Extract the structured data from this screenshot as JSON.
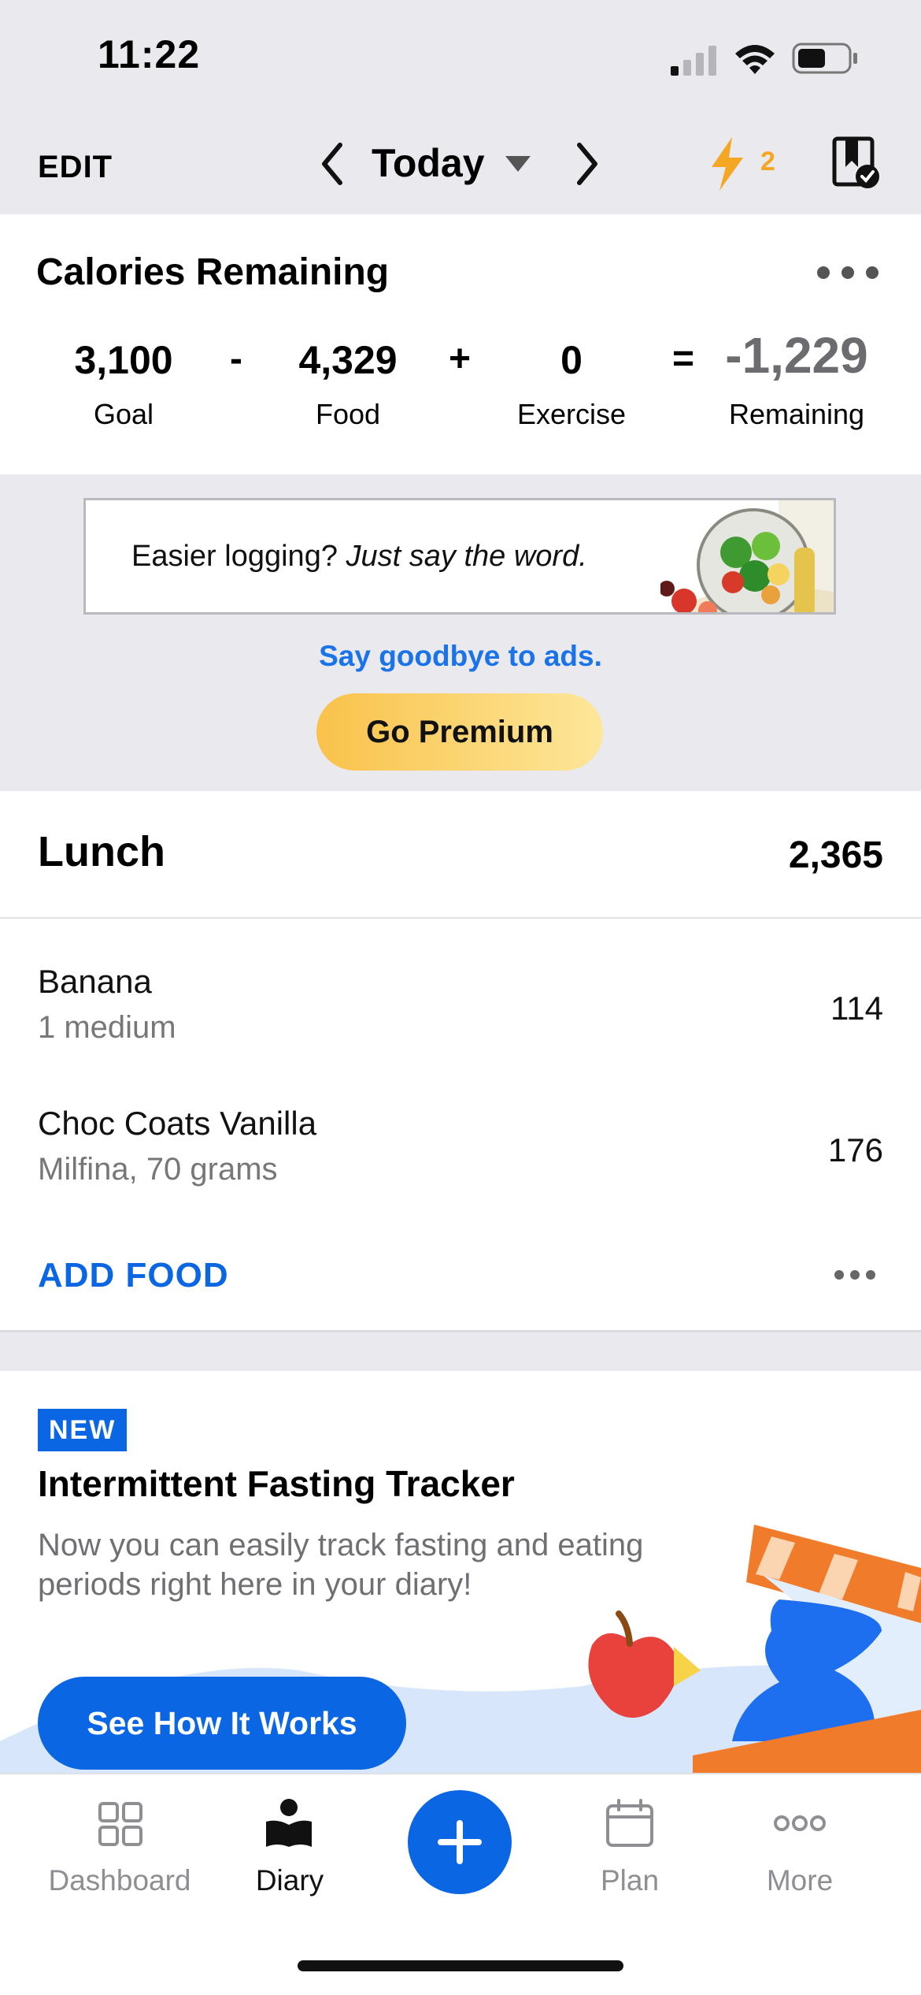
{
  "status_bar": {
    "time": "11:22"
  },
  "header": {
    "edit_label": "EDIT",
    "date_label": "Today",
    "streak_count": "2"
  },
  "calories": {
    "title": "Calories Remaining",
    "goal": "3,100",
    "goal_label": "Goal",
    "op_minus": "-",
    "food": "4,329",
    "food_label": "Food",
    "op_plus": "+",
    "exercise": "0",
    "exercise_label": "Exercise",
    "op_equals": "=",
    "remaining": "-1,229",
    "remaining_label": "Remaining"
  },
  "ad": {
    "text_normal": "Easier logging? ",
    "text_italic": "Just say the word.",
    "remove_ads_link": "Say goodbye to ads.",
    "premium_button": "Go Premium"
  },
  "meal": {
    "title": "Lunch",
    "total": "2,365",
    "items": [
      {
        "name": "Banana",
        "serving": "1 medium",
        "calories": "114"
      },
      {
        "name": "Choc Coats Vanilla",
        "serving": "Milfina, 70 grams",
        "calories": "176"
      }
    ],
    "add_food_label": "ADD FOOD"
  },
  "fasting": {
    "badge": "NEW",
    "title": "Intermittent Fasting Tracker",
    "description": "Now you can easily track fasting and eating periods right here in your diary!",
    "button": "See How It Works"
  },
  "tab_bar": {
    "dashboard": "Dashboard",
    "diary": "Diary",
    "plan": "Plan",
    "more": "More"
  },
  "colors": {
    "accent_blue": "#0b66e4",
    "streak_orange": "#f5a623",
    "premium_yellow": "#f9c24a"
  },
  "icons": [
    "cellular-icon",
    "wifi-icon",
    "battery-icon",
    "chevron-left-icon",
    "chevron-right-icon",
    "dropdown-caret-icon",
    "lightning-icon",
    "bookmark-check-icon",
    "more-dots-icon",
    "dashboard-icon",
    "diary-icon",
    "plus-icon",
    "calendar-icon",
    "more-icon"
  ]
}
